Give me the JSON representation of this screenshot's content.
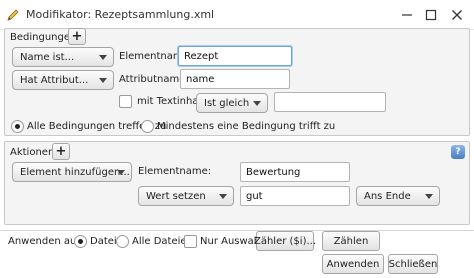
{
  "window": {
    "title": "Modifikator: Rezeptsammlung.xml"
  },
  "conditions": {
    "label": "Bedingungen",
    "row1": {
      "dropdown": "Name ist...",
      "label": "Elementname:",
      "value": "Rezept"
    },
    "row2": {
      "dropdown": "Hat Attribut...",
      "label": "Attributname:",
      "value": "name"
    },
    "row3": {
      "checkbox_label": "mit Textinhalt",
      "checked": false,
      "compare": "Ist gleich",
      "value": ""
    },
    "match": {
      "all_label": "Alle Bedingungen treffen zu",
      "any_label": "Mindestens eine Bedingung trifft zu",
      "selected": "all"
    }
  },
  "actions": {
    "label": "Aktionen",
    "row1": {
      "dropdown": "Element hinzufügen...",
      "label": "Elementname:",
      "value": "Bewertung"
    },
    "row2": {
      "dropdown": "Wert setzen",
      "value": "gut",
      "position": "Ans Ende"
    },
    "help_icon": "help-icon"
  },
  "apply": {
    "label": "Anwenden auf:",
    "options": [
      "Datei",
      "Alle Dateien"
    ],
    "selected": "Datei",
    "only_selection_label": "Nur Auswahl",
    "only_selection_checked": false,
    "counter_button": "Zähler ($i)...",
    "count_button": "Zählen"
  },
  "footer": {
    "apply_button": "Anwenden",
    "close_button": "Schließen"
  }
}
